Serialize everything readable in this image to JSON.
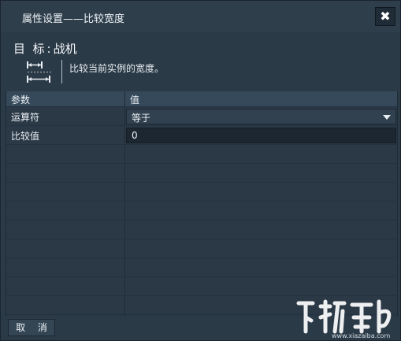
{
  "window": {
    "title": "属性设置——比较宽度",
    "close_glyph": "✖"
  },
  "target": {
    "label": "目  标",
    "colon": ":",
    "value": "战机",
    "description": "比较当前实例的宽度。",
    "icon": "width-compare-icon"
  },
  "grid": {
    "headers": [
      "参数",
      "值"
    ],
    "rows": [
      {
        "label": "运算符",
        "type": "select",
        "value": "等于"
      },
      {
        "label": "比较值",
        "type": "input",
        "value": "0"
      }
    ],
    "empty_rows": 9
  },
  "footer": {
    "cancel_label": "取 消"
  },
  "watermark": {
    "sub_text": "www.xiazaiba.com"
  },
  "colors": {
    "dialog_bg": "#2b3a47",
    "header_bg": "#35495a",
    "input_bg": "#1c2731"
  }
}
